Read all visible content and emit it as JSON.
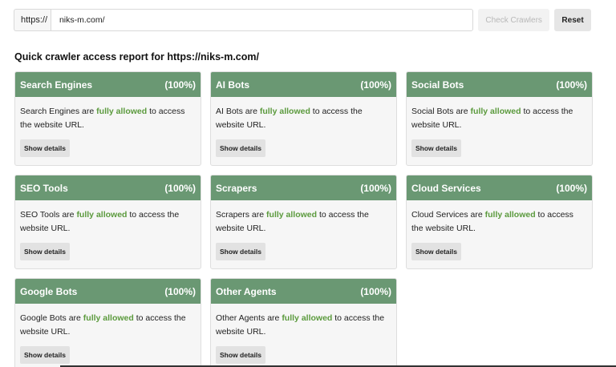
{
  "form": {
    "prefix": "https://",
    "url_value": "niks-m.com/",
    "check_label": "Check Crawlers",
    "reset_label": "Reset"
  },
  "report": {
    "heading": "Quick crawler access report for https://niks-m.com/",
    "cards": [
      {
        "title": "Search Engines",
        "percent": "(100%)",
        "text_before": "Search Engines are ",
        "status": "fully allowed",
        "text_after": " to access the website URL.",
        "button": "Show details"
      },
      {
        "title": "AI Bots",
        "percent": "(100%)",
        "text_before": "AI Bots are ",
        "status": "fully allowed",
        "text_after": " to access the website URL.",
        "button": "Show details"
      },
      {
        "title": "Social Bots",
        "percent": "(100%)",
        "text_before": "Social Bots are ",
        "status": "fully allowed",
        "text_after": " to access the website URL.",
        "button": "Show details"
      },
      {
        "title": "SEO Tools",
        "percent": "(100%)",
        "text_before": "SEO Tools are ",
        "status": "fully allowed",
        "text_after": " to access the website URL.",
        "button": "Show details"
      },
      {
        "title": "Scrapers",
        "percent": "(100%)",
        "text_before": "Scrapers are ",
        "status": "fully allowed",
        "text_after": " to access the website URL.",
        "button": "Show details"
      },
      {
        "title": "Cloud Services",
        "percent": "(100%)",
        "text_before": "Cloud Services are ",
        "status": "fully allowed",
        "text_after": " to access the website URL.",
        "button": "Show details"
      },
      {
        "title": "Google Bots",
        "percent": "(100%)",
        "text_before": "Google Bots are ",
        "status": "fully allowed",
        "text_after": " to access the website URL.",
        "button": "Show details"
      },
      {
        "title": "Other Agents",
        "percent": "(100%)",
        "text_before": "Other Agents are ",
        "status": "fully allowed",
        "text_after": " to access the website URL.",
        "button": "Show details"
      }
    ]
  },
  "colors": {
    "header_green": "#6a9873",
    "allowed_green": "#5b9a3d"
  }
}
